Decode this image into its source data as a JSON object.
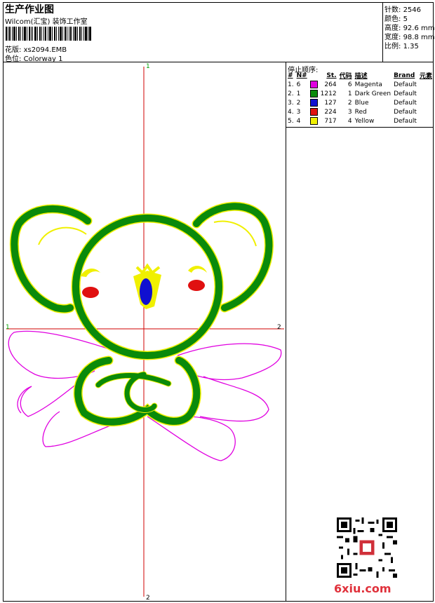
{
  "header": {
    "title": "生产作业图",
    "company": "Wilcom(汇宝) 装饰工作室",
    "design_label": "花版:",
    "design_value": "xs2094.EMB",
    "colorway_label": "色位:",
    "colorway_value": "Colorway 1"
  },
  "stats": [
    {
      "label": "针数:",
      "value": "2546"
    },
    {
      "label": "颜色:",
      "value": "5"
    },
    {
      "label": "高度:",
      "value": "92.6 mm"
    },
    {
      "label": "宽度:",
      "value": "98.8 mm"
    },
    {
      "label": "比例:",
      "value": "1.35"
    }
  ],
  "sequence": {
    "title": "停止顺序:",
    "columns": [
      "#",
      "N#",
      "",
      "St.",
      "代码",
      "描述",
      "Brand",
      "元素"
    ],
    "rows": [
      {
        "idx": "1.",
        "n": "6",
        "color": "#e000e0",
        "st": "264",
        "code": "6",
        "desc": "Magenta",
        "brand": "Default"
      },
      {
        "idx": "2.",
        "n": "1",
        "color": "#0a8a0a",
        "st": "1212",
        "code": "1",
        "desc": "Dark Green",
        "brand": "Default"
      },
      {
        "idx": "3.",
        "n": "2",
        "color": "#1010d0",
        "st": "127",
        "code": "2",
        "desc": "Blue",
        "brand": "Default"
      },
      {
        "idx": "4.",
        "n": "3",
        "color": "#e01010",
        "st": "224",
        "code": "3",
        "desc": "Red",
        "brand": "Default"
      },
      {
        "idx": "5.",
        "n": "4",
        "color": "#f0f000",
        "st": "717",
        "code": "4",
        "desc": "Yellow",
        "brand": "Default"
      }
    ]
  },
  "axes": {
    "top": "1",
    "bottom": "2",
    "left": "1",
    "right": "2"
  },
  "watermark": "6xiu.com",
  "icons": {
    "barcode": "barcode-icon",
    "qr": "qr-code-icon"
  }
}
